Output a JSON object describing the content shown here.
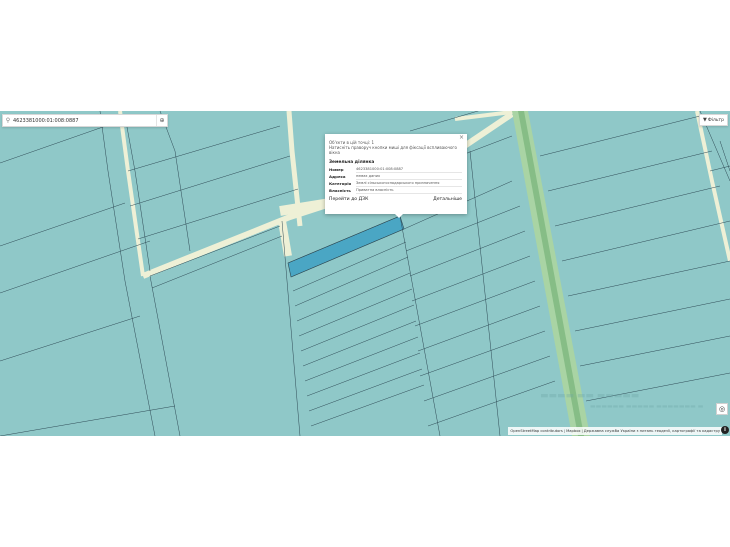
{
  "search": {
    "value": "4623381000:01:008:0887",
    "icon": "search-icon",
    "locate_icon": "crosshair-icon"
  },
  "filter": {
    "label": "Фільтр",
    "icon": "funnel-icon"
  },
  "popup": {
    "line1": "Об'єкти в цій точці: 1",
    "line2": "Натисніть праворуч кнопки миші для фіксації вспливаючого вікна",
    "section_title": "Земельна ділянка",
    "fields": [
      {
        "label": "Номер",
        "value": "4623381000:01:008:0887"
      },
      {
        "label": "Адреса",
        "value": "немає даних"
      },
      {
        "label": "Категорія",
        "value": "Землі сільськогосподарського призначення"
      },
      {
        "label": "Власність",
        "value": "Приватна власність"
      }
    ],
    "action_left": "Перейти до ДЗК",
    "action_right": "Детальніше",
    "close_icon": "close-icon"
  },
  "attribution": {
    "osm": "OpenStreetMap contributors",
    "mapbox": "Mapbox",
    "rest": "Державна служба України з питань геодезії, картографії та кадастру"
  },
  "colors": {
    "parcel_fill": "#8fc8c8",
    "parcel_line": "#2e4a55",
    "road": "#eef0d6",
    "highlight": "#4aa6c4",
    "green_strip": "#8bc08c"
  }
}
